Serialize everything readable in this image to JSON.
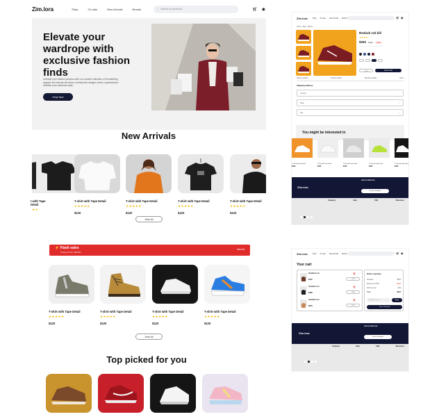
{
  "brand": {
    "logo": "Zim.lora"
  },
  "nav": {
    "links": [
      "Shop",
      "On sale",
      "New Arrivals",
      "Brands"
    ],
    "search_placeholder": "Search for products..."
  },
  "hero": {
    "title": "Elevate your wardrope with exclusive fashion finds",
    "body": "Unleash your fashion persona with our curated collection of trendsetting apparel and elevate the allure of distinctive designs where sophistication redefine your wardrobe style.",
    "cta": "Shop Now"
  },
  "new_arrivals": {
    "title": "New Arrivals",
    "items": [
      {
        "name": "t with Tape Detail",
        "stars": "★★",
        "price": ""
      },
      {
        "name": "T-shirt with Tape Detail",
        "stars": "★★★★★",
        "price": "$120"
      },
      {
        "name": "T-shirt with Tape Detail",
        "stars": "★★★★★",
        "price": "$120"
      },
      {
        "name": "T-shirt with Tape Detail",
        "stars": "★★★★★",
        "price": "$120"
      },
      {
        "name": "T-shirt with Tape Detail",
        "stars": "★★★★★",
        "price": "$120"
      }
    ],
    "view_all": "View All"
  },
  "flash": {
    "title": "Flash sales",
    "subtitle": "Timing end 11d : 00h:00m",
    "link": "View All"
  },
  "flash_items": [
    {
      "name": "T-shirt with Tape Detail",
      "stars": "★★★★★",
      "price": "$120"
    },
    {
      "name": "T-shirt with Tape Detail",
      "stars": "★★★★★",
      "price": "$120"
    },
    {
      "name": "T-shirt with Tape Detail",
      "stars": "★★★★★",
      "price": "$120"
    },
    {
      "name": "T-shirt with Tape Detail",
      "stars": "★★★★★",
      "price": "$120"
    }
  ],
  "flash_view_all": "View All",
  "top_picked": {
    "title": "Top picked for you"
  },
  "product": {
    "title": "Reebok red kill",
    "price": "$260",
    "old_price": "$300",
    "discount": "-40%",
    "add_label": "Add to Cart",
    "tabs": [
      "Delivery details",
      "Product details",
      "Warranty Details",
      "Sizes"
    ],
    "section": "Shipping Address",
    "fields": [
      "Country",
      "State",
      "City"
    ]
  },
  "interested": {
    "title": "You might be interested in",
    "items": [
      {
        "name": "T-shirt with Tape Detail",
        "price": "$120"
      },
      {
        "name": "T-shirt with Tape Detail",
        "price": "$120"
      },
      {
        "name": "T-shirt with Tape Detail",
        "price": "$120"
      },
      {
        "name": "T-shirt with Tape Detail",
        "price": "$120"
      },
      {
        "name": "T-shirt with Tape Detail",
        "price": "$120"
      }
    ]
  },
  "footer": {
    "news_title": "Join to Zim.lora",
    "cta": "Join the newsletter",
    "columns": [
      "Company",
      "Help",
      "FAQ",
      "Resources"
    ]
  },
  "cart": {
    "title": "Your cart",
    "items": [
      {
        "name": "Gradient red",
        "price": "$145"
      },
      {
        "name": "Gradient red",
        "price": "$180"
      },
      {
        "name": "Gradient red",
        "price": "$240"
      }
    ],
    "summary_title": "Order summary",
    "summary_rows": [
      {
        "label": "Subtotal",
        "value": "$565"
      },
      {
        "label": "Discount (-20%)",
        "value": "-$113"
      },
      {
        "label": "Delivery Fee",
        "value": "$15"
      },
      {
        "label": "Total",
        "value": "$467"
      }
    ],
    "promo_placeholder": "Add promo code",
    "apply": "Apply",
    "checkout": "Go to Checkout"
  },
  "colors": {
    "accent": "#121736",
    "flash": "#e02b2b",
    "star": "#f5b400"
  }
}
